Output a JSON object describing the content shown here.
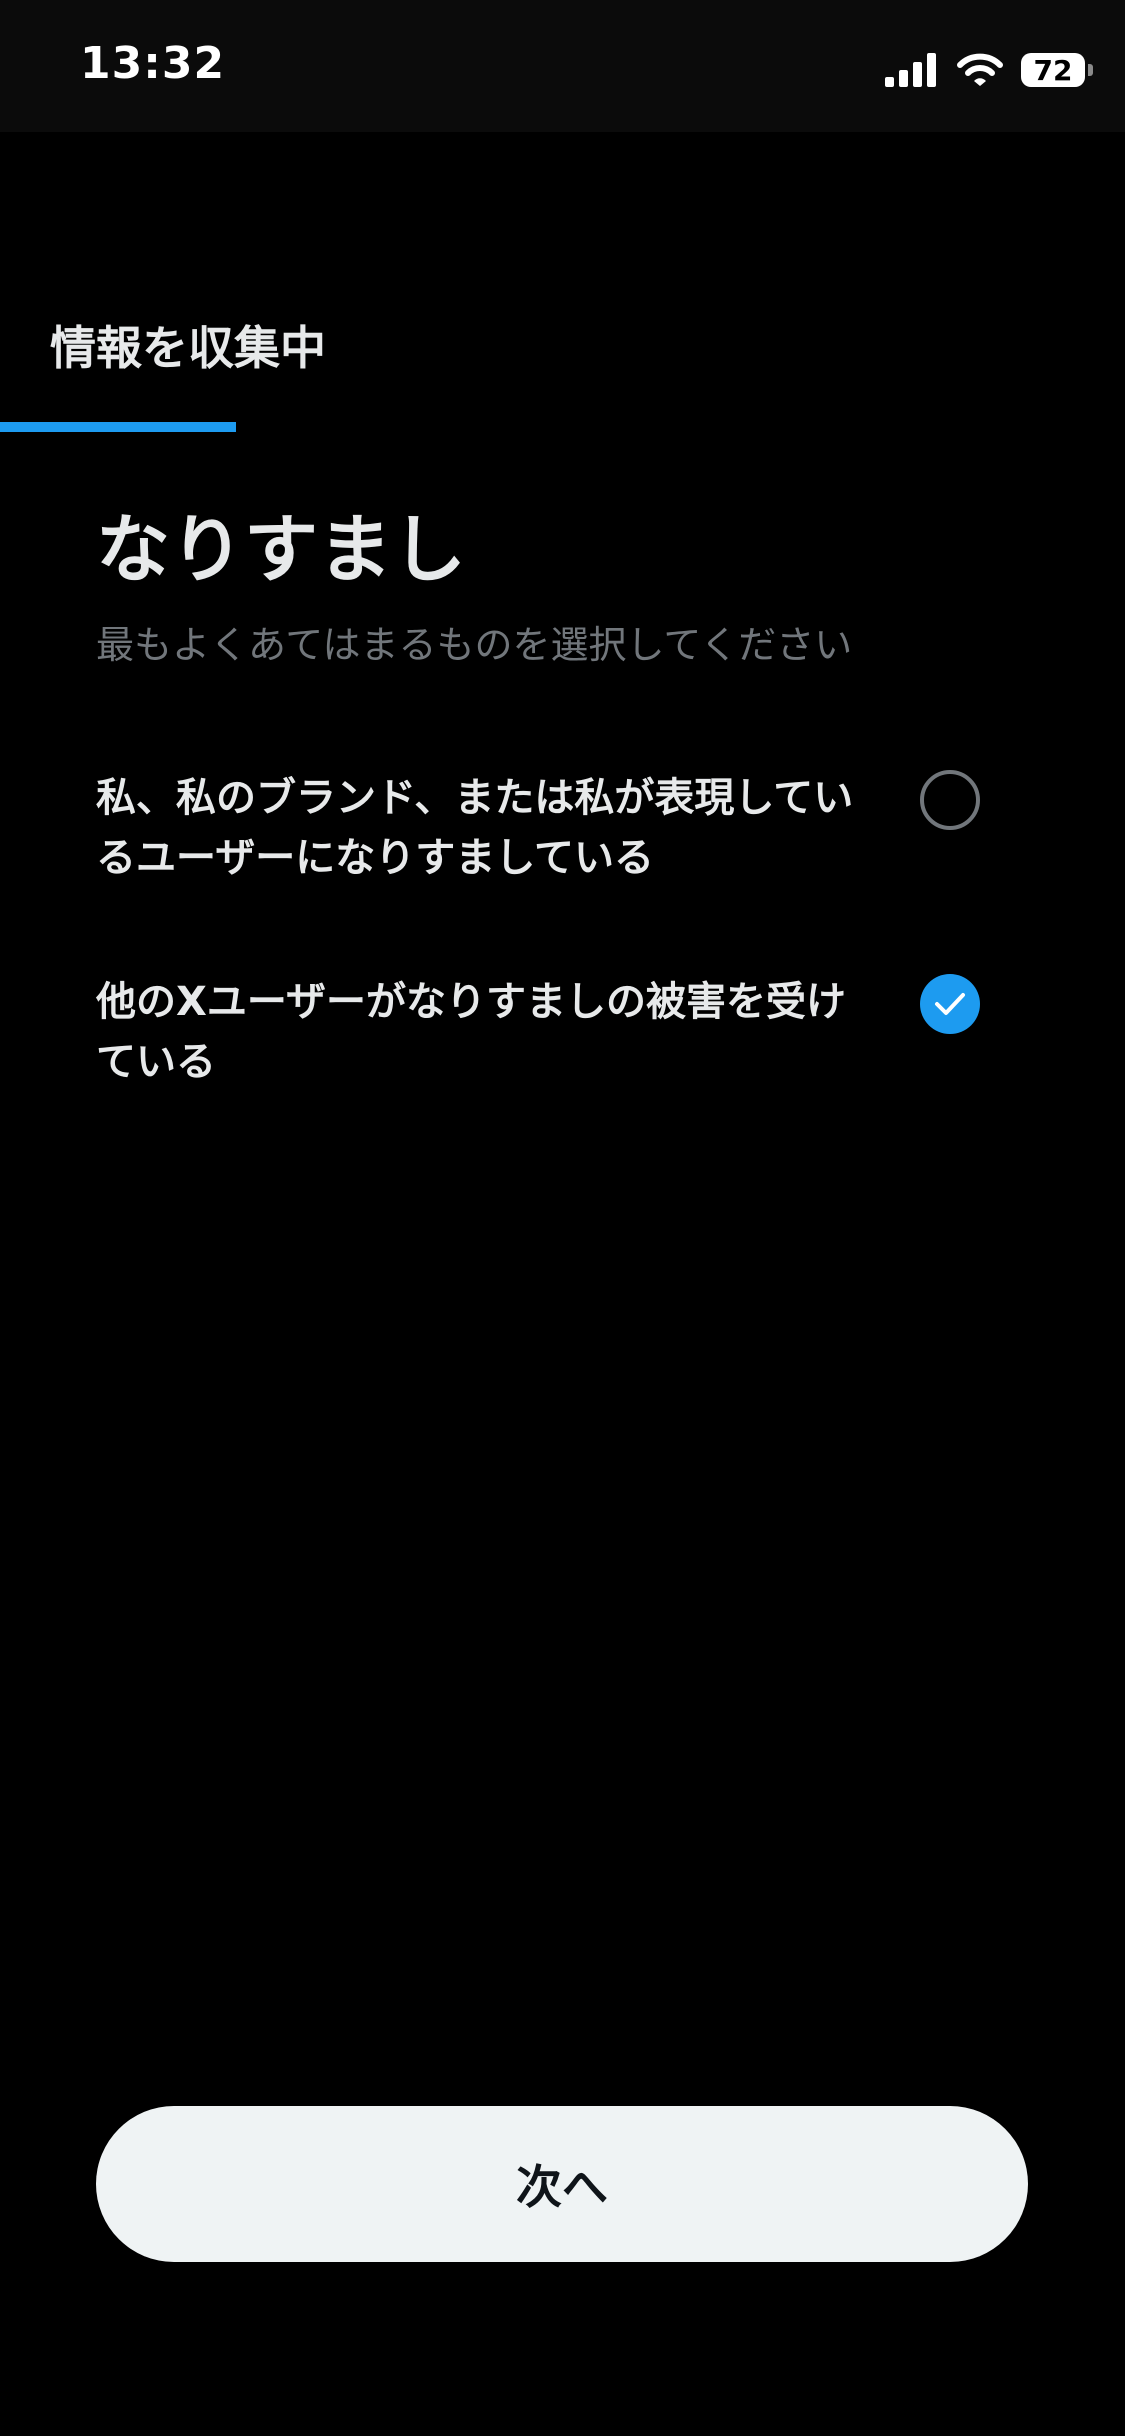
{
  "status_bar": {
    "time": "13:32",
    "battery": "72"
  },
  "header": {
    "step_label": "情報を収集中",
    "progress": 0.21
  },
  "main": {
    "title": "なりすまし",
    "subtitle": "最もよくあてはまるものを選択してください",
    "options": [
      {
        "label": "私、私のブランド、または私が表現しているユーザーになりすましている",
        "selected": false
      },
      {
        "label": "他のXユーザーがなりすましの被害を受けている",
        "selected": true
      }
    ]
  },
  "footer": {
    "next_label": "次へ"
  },
  "colors": {
    "accent": "#1d9bf0",
    "background": "#000000",
    "text": "#e7e9ea",
    "muted": "#71767b",
    "button": "#eff3f4"
  },
  "icons": {
    "cellular": "cellular-signal-icon",
    "wifi": "wifi-icon",
    "battery": "battery-icon",
    "check": "checkmark-icon"
  }
}
